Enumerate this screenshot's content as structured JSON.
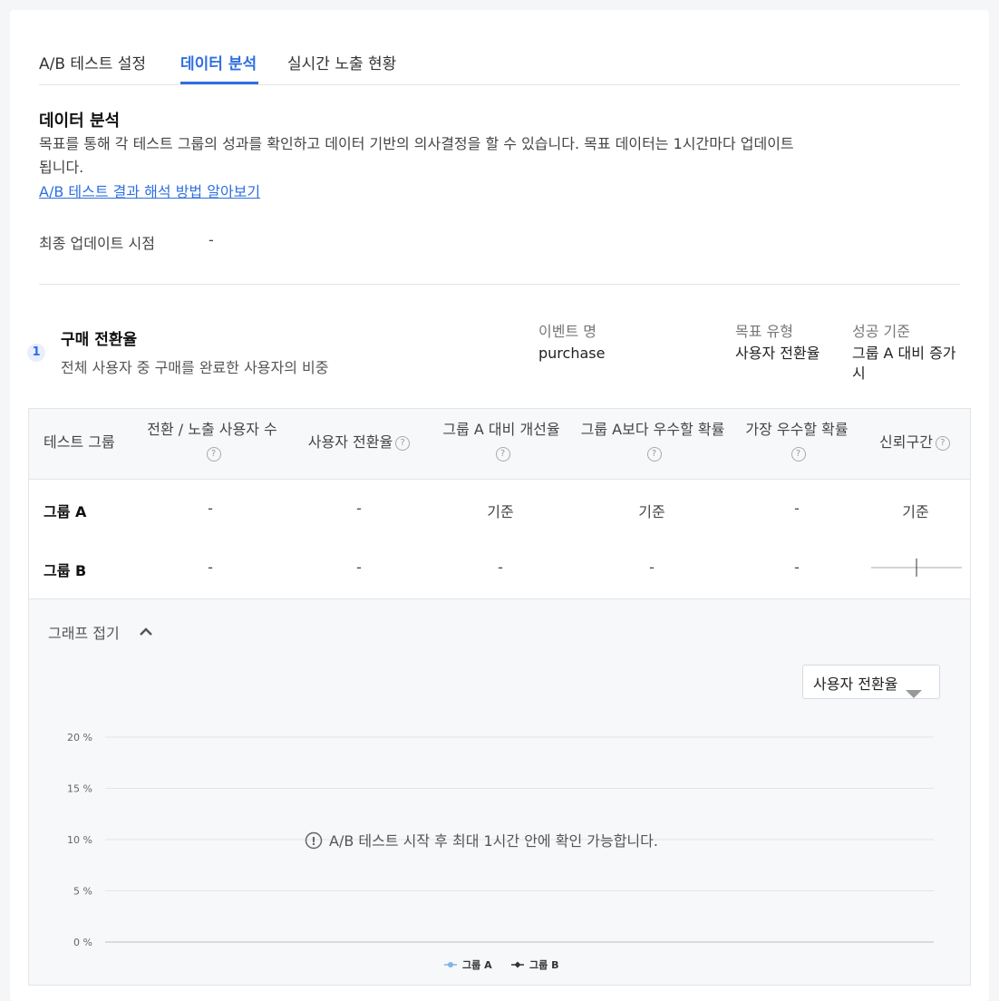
{
  "tabs": [
    {
      "label": "A/B 테스트 설정",
      "active": false
    },
    {
      "label": "데이터 분석",
      "active": true
    },
    {
      "label": "실시간 노출 현황",
      "active": false
    }
  ],
  "section": {
    "title": "데이터 분석",
    "description": "목표를 통해 각 테스트 그룹의 성과를 확인하고 데이터 기반의 의사결정을 할 수 있습니다. 목표 데이터는 1시간마다 업데이트 됩니다.",
    "help_link": "A/B 테스트 결과 해석 방법 알아보기",
    "last_update_label": "최종 업데이트 시점",
    "last_update_value": "-"
  },
  "goal": {
    "index": "1",
    "name": "구매 전환율",
    "description": "전체 사용자 중 구매를 완료한 사용자의 비중",
    "event_label": "이벤트 명",
    "event_value": "purchase",
    "type_label": "목표 유형",
    "type_value": "사용자 전환율",
    "criteria_label": "성공 기준",
    "criteria_value": "그룹 A 대비 증가시"
  },
  "table": {
    "headers": [
      "테스트 그룹",
      "전환 / 노출 사용자 수",
      "사용자 전환율",
      "그룹 A 대비 개선율",
      "그룹 A보다 우수할 확률",
      "가장 우수할 확률",
      "신뢰구간"
    ],
    "help_icon": "?",
    "rows": [
      {
        "group": "그룹 A",
        "count": "-",
        "rate": "-",
        "improvement": "기준",
        "prob_better": "기준",
        "prob_best": "-",
        "ci": "기준"
      },
      {
        "group": "그룹 B",
        "count": "-",
        "rate": "-",
        "improvement": "-",
        "prob_better": "-",
        "prob_best": "-",
        "ci": ""
      }
    ]
  },
  "graph": {
    "collapse_label": "그래프 접기",
    "metric_select": "사용자 전환율",
    "empty_message": "A/B 테스트 시작 후 최대 1시간 안에 확인 가능합니다."
  },
  "chart_data": {
    "type": "line",
    "title": "",
    "xlabel": "",
    "ylabel": "",
    "y_ticks": [
      "0 %",
      "5 %",
      "10 %",
      "15 %",
      "20 %"
    ],
    "ylim": [
      0,
      20
    ],
    "grid": true,
    "legend_position": "bottom",
    "series": [
      {
        "name": "그룹 A",
        "values": [],
        "color": "#7fb3e6"
      },
      {
        "name": "그룹 B",
        "values": [],
        "color": "#333333"
      }
    ]
  },
  "colors": {
    "accent": "#2f6fe0",
    "border": "#e2e4e8"
  }
}
